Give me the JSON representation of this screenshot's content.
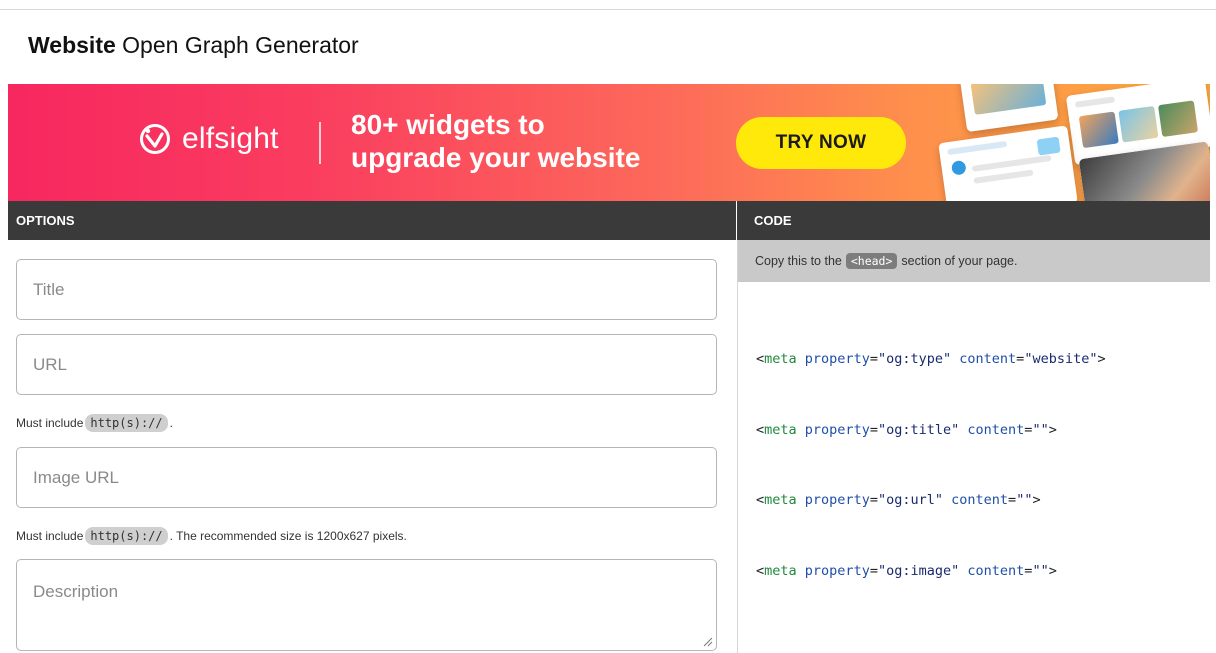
{
  "page": {
    "title_strong": "Website",
    "title_rest": "Open Graph Generator"
  },
  "banner": {
    "logo_text": "elfsight",
    "headline_line1": "80+ widgets to",
    "headline_line2": "upgrade your website",
    "cta_label": "TRY NOW",
    "accent_yellow": "#ffe90a",
    "gradient_start": "#f7275f",
    "gradient_end": "#fdaa3f"
  },
  "options": {
    "header": "OPTIONS",
    "title_placeholder": "Title",
    "title_value": "",
    "url_placeholder": "URL",
    "url_value": "",
    "url_hint_prefix": "Must include",
    "url_hint_code": "http(s)://",
    "url_hint_suffix": ".",
    "image_placeholder": "Image URL",
    "image_value": "",
    "image_hint_prefix": "Must include",
    "image_hint_code": "http(s)://",
    "image_hint_suffix": ". The recommended size is 1200x627 pixels.",
    "description_placeholder": "Description",
    "description_value": ""
  },
  "code": {
    "header": "CODE",
    "note_prefix": "Copy this to the",
    "note_code": "<head>",
    "note_suffix": "section of your page.",
    "lines": [
      {
        "tag": "meta",
        "attr1": "property",
        "val1": "\"og:type\"",
        "attr2": "content",
        "val2": "\"website\""
      },
      {
        "tag": "meta",
        "attr1": "property",
        "val1": "\"og:title\"",
        "attr2": "content",
        "val2": "\"\""
      },
      {
        "tag": "meta",
        "attr1": "property",
        "val1": "\"og:url\"",
        "attr2": "content",
        "val2": "\"\""
      },
      {
        "tag": "meta",
        "attr1": "property",
        "val1": "\"og:image\"",
        "attr2": "content",
        "val2": "\"\""
      }
    ]
  }
}
